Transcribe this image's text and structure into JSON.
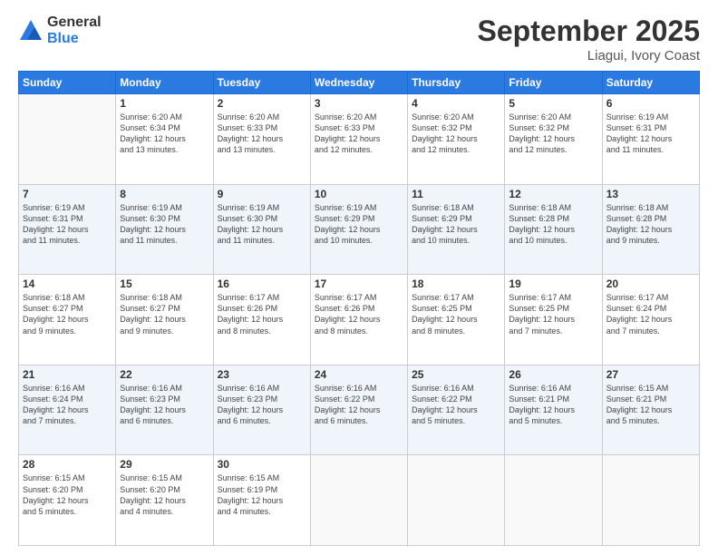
{
  "logo": {
    "general": "General",
    "blue": "Blue"
  },
  "header": {
    "month": "September 2025",
    "location": "Liagui, Ivory Coast"
  },
  "days": [
    "Sunday",
    "Monday",
    "Tuesday",
    "Wednesday",
    "Thursday",
    "Friday",
    "Saturday"
  ],
  "weeks": [
    [
      {
        "day": "",
        "info": ""
      },
      {
        "day": "1",
        "info": "Sunrise: 6:20 AM\nSunset: 6:34 PM\nDaylight: 12 hours\nand 13 minutes."
      },
      {
        "day": "2",
        "info": "Sunrise: 6:20 AM\nSunset: 6:33 PM\nDaylight: 12 hours\nand 13 minutes."
      },
      {
        "day": "3",
        "info": "Sunrise: 6:20 AM\nSunset: 6:33 PM\nDaylight: 12 hours\nand 12 minutes."
      },
      {
        "day": "4",
        "info": "Sunrise: 6:20 AM\nSunset: 6:32 PM\nDaylight: 12 hours\nand 12 minutes."
      },
      {
        "day": "5",
        "info": "Sunrise: 6:20 AM\nSunset: 6:32 PM\nDaylight: 12 hours\nand 12 minutes."
      },
      {
        "day": "6",
        "info": "Sunrise: 6:19 AM\nSunset: 6:31 PM\nDaylight: 12 hours\nand 11 minutes."
      }
    ],
    [
      {
        "day": "7",
        "info": "Sunrise: 6:19 AM\nSunset: 6:31 PM\nDaylight: 12 hours\nand 11 minutes."
      },
      {
        "day": "8",
        "info": "Sunrise: 6:19 AM\nSunset: 6:30 PM\nDaylight: 12 hours\nand 11 minutes."
      },
      {
        "day": "9",
        "info": "Sunrise: 6:19 AM\nSunset: 6:30 PM\nDaylight: 12 hours\nand 11 minutes."
      },
      {
        "day": "10",
        "info": "Sunrise: 6:19 AM\nSunset: 6:29 PM\nDaylight: 12 hours\nand 10 minutes."
      },
      {
        "day": "11",
        "info": "Sunrise: 6:18 AM\nSunset: 6:29 PM\nDaylight: 12 hours\nand 10 minutes."
      },
      {
        "day": "12",
        "info": "Sunrise: 6:18 AM\nSunset: 6:28 PM\nDaylight: 12 hours\nand 10 minutes."
      },
      {
        "day": "13",
        "info": "Sunrise: 6:18 AM\nSunset: 6:28 PM\nDaylight: 12 hours\nand 9 minutes."
      }
    ],
    [
      {
        "day": "14",
        "info": "Sunrise: 6:18 AM\nSunset: 6:27 PM\nDaylight: 12 hours\nand 9 minutes."
      },
      {
        "day": "15",
        "info": "Sunrise: 6:18 AM\nSunset: 6:27 PM\nDaylight: 12 hours\nand 9 minutes."
      },
      {
        "day": "16",
        "info": "Sunrise: 6:17 AM\nSunset: 6:26 PM\nDaylight: 12 hours\nand 8 minutes."
      },
      {
        "day": "17",
        "info": "Sunrise: 6:17 AM\nSunset: 6:26 PM\nDaylight: 12 hours\nand 8 minutes."
      },
      {
        "day": "18",
        "info": "Sunrise: 6:17 AM\nSunset: 6:25 PM\nDaylight: 12 hours\nand 8 minutes."
      },
      {
        "day": "19",
        "info": "Sunrise: 6:17 AM\nSunset: 6:25 PM\nDaylight: 12 hours\nand 7 minutes."
      },
      {
        "day": "20",
        "info": "Sunrise: 6:17 AM\nSunset: 6:24 PM\nDaylight: 12 hours\nand 7 minutes."
      }
    ],
    [
      {
        "day": "21",
        "info": "Sunrise: 6:16 AM\nSunset: 6:24 PM\nDaylight: 12 hours\nand 7 minutes."
      },
      {
        "day": "22",
        "info": "Sunrise: 6:16 AM\nSunset: 6:23 PM\nDaylight: 12 hours\nand 6 minutes."
      },
      {
        "day": "23",
        "info": "Sunrise: 6:16 AM\nSunset: 6:23 PM\nDaylight: 12 hours\nand 6 minutes."
      },
      {
        "day": "24",
        "info": "Sunrise: 6:16 AM\nSunset: 6:22 PM\nDaylight: 12 hours\nand 6 minutes."
      },
      {
        "day": "25",
        "info": "Sunrise: 6:16 AM\nSunset: 6:22 PM\nDaylight: 12 hours\nand 5 minutes."
      },
      {
        "day": "26",
        "info": "Sunrise: 6:16 AM\nSunset: 6:21 PM\nDaylight: 12 hours\nand 5 minutes."
      },
      {
        "day": "27",
        "info": "Sunrise: 6:15 AM\nSunset: 6:21 PM\nDaylight: 12 hours\nand 5 minutes."
      }
    ],
    [
      {
        "day": "28",
        "info": "Sunrise: 6:15 AM\nSunset: 6:20 PM\nDaylight: 12 hours\nand 5 minutes."
      },
      {
        "day": "29",
        "info": "Sunrise: 6:15 AM\nSunset: 6:20 PM\nDaylight: 12 hours\nand 4 minutes."
      },
      {
        "day": "30",
        "info": "Sunrise: 6:15 AM\nSunset: 6:19 PM\nDaylight: 12 hours\nand 4 minutes."
      },
      {
        "day": "",
        "info": ""
      },
      {
        "day": "",
        "info": ""
      },
      {
        "day": "",
        "info": ""
      },
      {
        "day": "",
        "info": ""
      }
    ]
  ]
}
